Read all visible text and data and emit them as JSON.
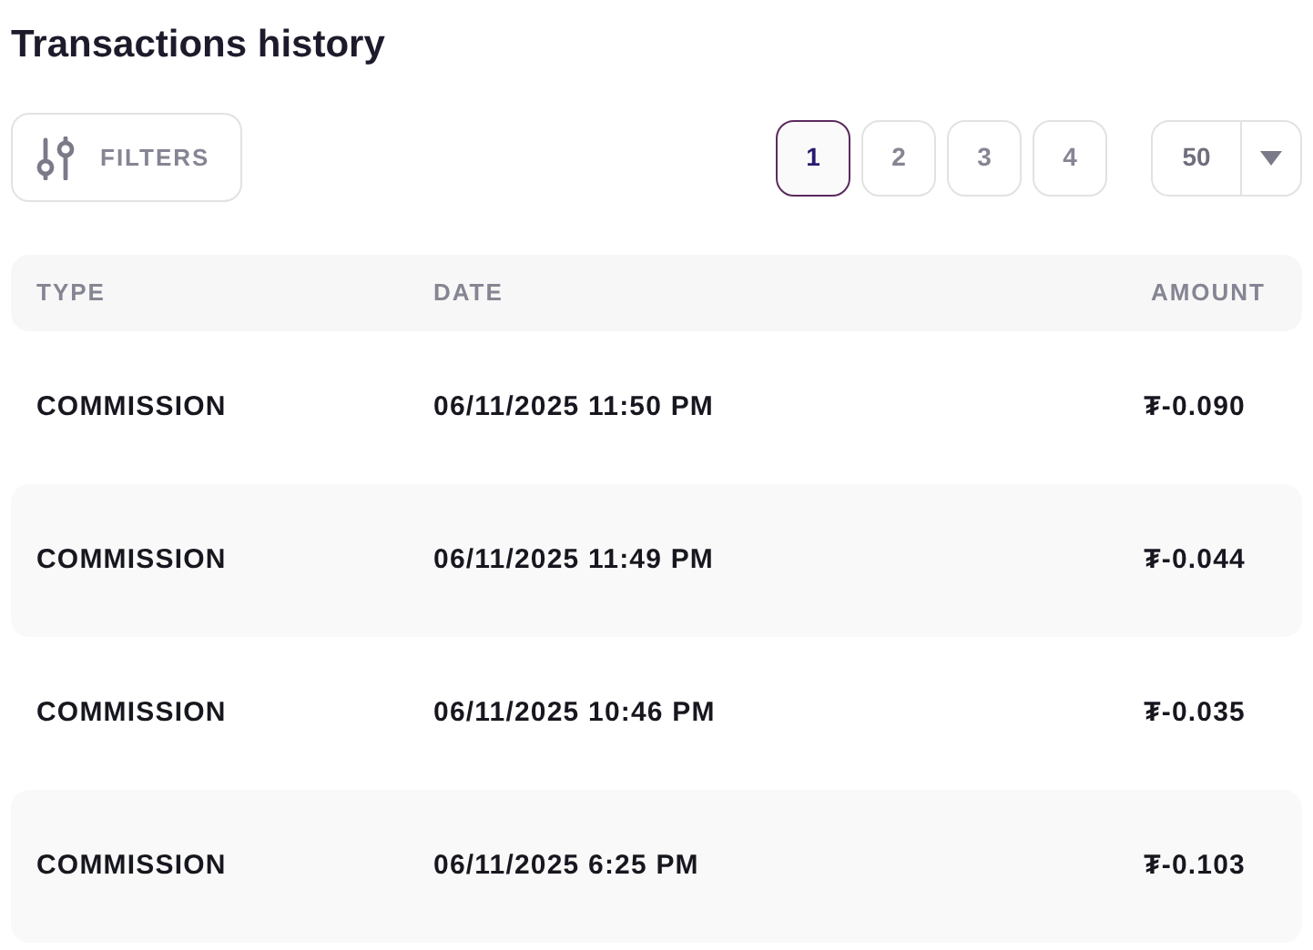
{
  "title": "Transactions history",
  "filters_button": {
    "label": "FILTERS"
  },
  "pagination": [
    {
      "label": "1",
      "selected": true
    },
    {
      "label": "2",
      "selected": false
    },
    {
      "label": "3",
      "selected": false
    },
    {
      "label": "4",
      "selected": false
    }
  ],
  "page_size": {
    "value": "50"
  },
  "table": {
    "columns": [
      "TYPE",
      "DATE",
      "AMOUNT"
    ],
    "rows": [
      {
        "type": "COMMISSION",
        "date": "06/11/2025 11:50 PM",
        "amount": "₮-0.090"
      },
      {
        "type": "COMMISSION",
        "date": "06/11/2025 11:49 PM",
        "amount": "₮-0.044"
      },
      {
        "type": "COMMISSION",
        "date": "06/11/2025 10:46 PM",
        "amount": "₮-0.035"
      },
      {
        "type": "COMMISSION",
        "date": "06/11/2025 6:25 PM",
        "amount": "₮-0.103"
      }
    ]
  }
}
